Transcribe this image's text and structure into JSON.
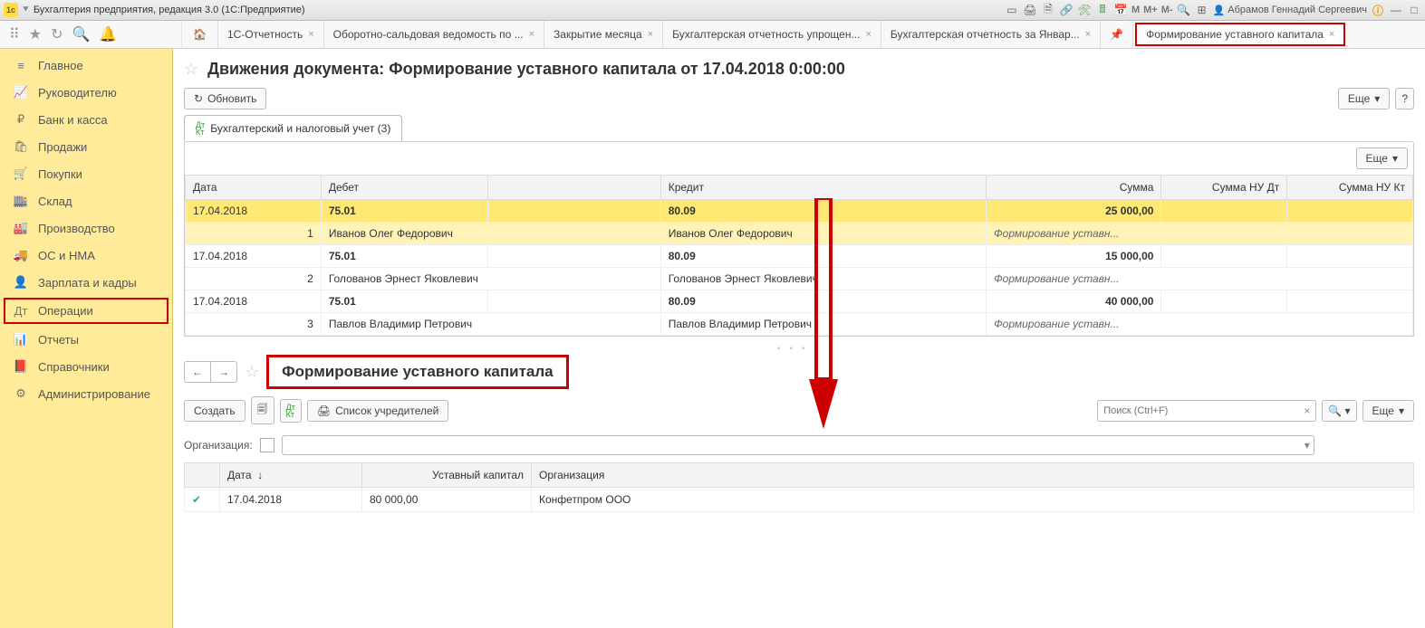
{
  "titlebar": {
    "app": "Бухгалтерия предприятия, редакция 3.0  (1С:Предприятие)",
    "user": "Абрамов Геннадий Сергеевич",
    "M": "M",
    "Mp": "M+",
    "Mm": "M-"
  },
  "tabs": [
    {
      "label": "1С-Отчетность"
    },
    {
      "label": "Оборотно-сальдовая ведомость по ..."
    },
    {
      "label": "Закрытие месяца"
    },
    {
      "label": "Бухгалтерская отчетность упрощен..."
    },
    {
      "label": "Бухгалтерская отчетность за Январ..."
    },
    {
      "label": "Формирование уставного капитала",
      "active": true
    }
  ],
  "sidebar": [
    {
      "icon": "≡",
      "label": "Главное"
    },
    {
      "icon": "📈",
      "label": "Руководителю"
    },
    {
      "icon": "₽",
      "label": "Банк и касса"
    },
    {
      "icon": "🛍",
      "label": "Продажи"
    },
    {
      "icon": "🛒",
      "label": "Покупки"
    },
    {
      "icon": "🏬",
      "label": "Склад"
    },
    {
      "icon": "🏭",
      "label": "Производство"
    },
    {
      "icon": "🚚",
      "label": "ОС и НМА"
    },
    {
      "icon": "👤",
      "label": "Зарплата и кадры"
    },
    {
      "icon": "Дт",
      "label": "Операции",
      "hl": true
    },
    {
      "icon": "📊",
      "label": "Отчеты"
    },
    {
      "icon": "📕",
      "label": "Справочники"
    },
    {
      "icon": "⚙",
      "label": "Администрирование"
    }
  ],
  "doc": {
    "title": "Движения документа: Формирование уставного капитала от 17.04.2018 0:00:00",
    "refresh": "Обновить",
    "more": "Еще",
    "help": "?",
    "subtab": "Бухгалтерский и налоговый учет (3)",
    "more2": "Еще"
  },
  "gridH": [
    "Дата",
    "Дебет",
    "",
    "Кредит",
    "Сумма",
    "Сумма НУ Дт",
    "Сумма НУ Кт"
  ],
  "rows": [
    {
      "date": "17.04.2018",
      "dt": "75.01",
      "kt": "80.09",
      "sum": "25 000,00",
      "n": "1",
      "who": "Иванов Олег Федорович",
      "who2": "Иванов Олег Федорович",
      "t": "Формирование уставн...",
      "hl": true
    },
    {
      "date": "17.04.2018",
      "dt": "75.01",
      "kt": "80.09",
      "sum": "15 000,00",
      "n": "2",
      "who": "Голованов Эрнест Яковлевич",
      "who2": "Голованов Эрнест Яковлевич",
      "t": "Формирование уставн..."
    },
    {
      "date": "17.04.2018",
      "dt": "75.01",
      "kt": "80.09",
      "sum": "40 000,00",
      "n": "3",
      "who": "Павлов Владимир Петрович",
      "who2": "Павлов Владимир Петрович",
      "t": "Формирование уставн..."
    }
  ],
  "sec2": {
    "title": "Формирование уставного капитала",
    "create": "Создать",
    "list": "Список учредителей",
    "searchPH": "Поиск (Ctrl+F)",
    "orgLabel": "Организация:",
    "more": "Еще"
  },
  "grid2H": {
    "date": "Дата",
    "cap": "Уставный капитал",
    "org": "Организация",
    "sort": "↓"
  },
  "grid2R": {
    "date": "17.04.2018",
    "cap": "80 000,00",
    "org": "Конфетпром ООО"
  }
}
